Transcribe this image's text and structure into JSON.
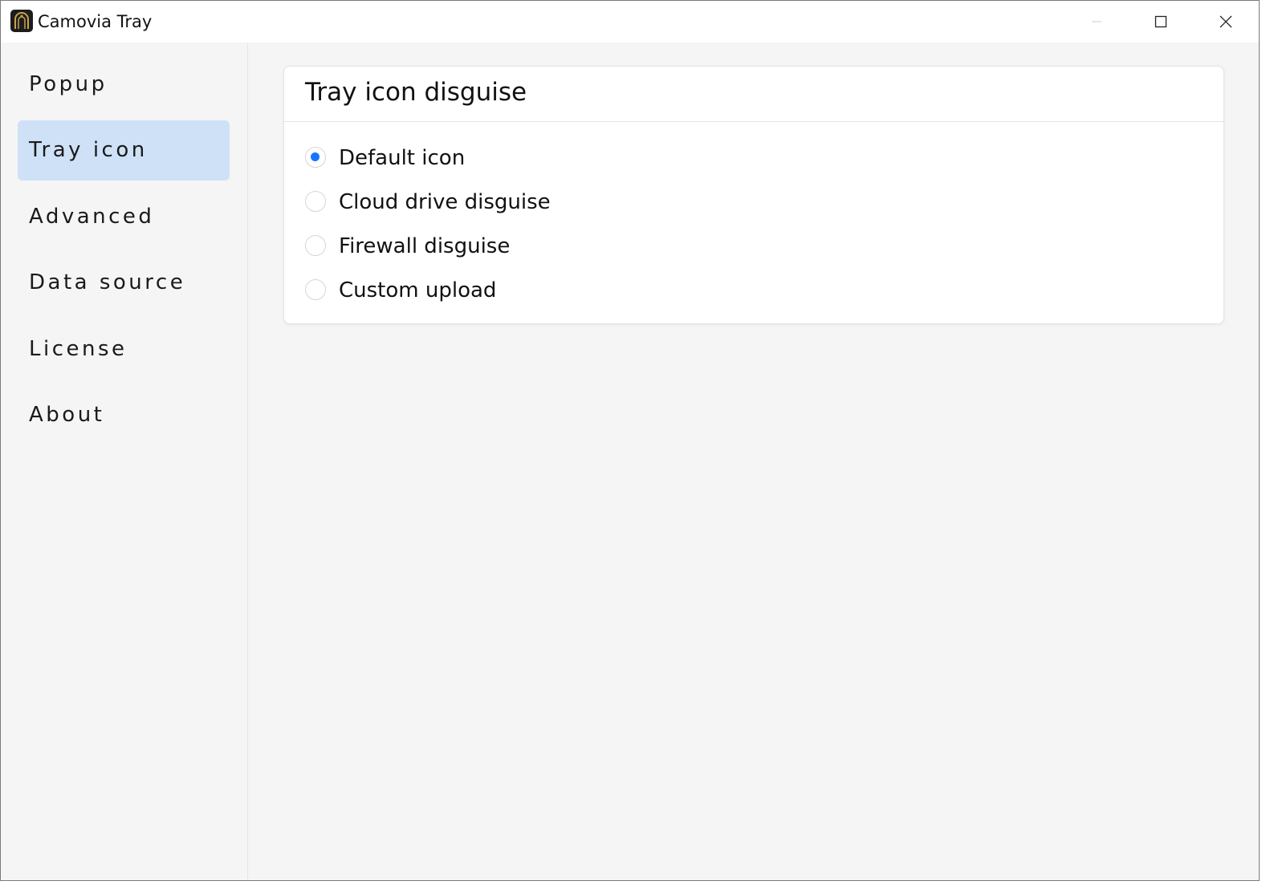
{
  "window": {
    "title": "Camovia Tray",
    "icon": "app-logo-icon",
    "controls": [
      "minimize-icon",
      "maximize-icon",
      "close-icon"
    ]
  },
  "sidebar": {
    "items": [
      {
        "label": "Popup",
        "active": false
      },
      {
        "label": "Tray icon",
        "active": true
      },
      {
        "label": "Advanced",
        "active": false
      },
      {
        "label": "Data source",
        "active": false
      },
      {
        "label": "License",
        "active": false
      },
      {
        "label": "About",
        "active": false
      }
    ]
  },
  "main": {
    "card_title": "Tray icon disguise",
    "options": [
      {
        "label": "Default icon",
        "checked": true
      },
      {
        "label": "Cloud drive disguise",
        "checked": false
      },
      {
        "label": "Firewall disguise",
        "checked": false
      },
      {
        "label": "Custom upload",
        "checked": false
      }
    ]
  },
  "colors": {
    "accent": "#1677ff",
    "nav_active_bg": "#cfe1f7",
    "background": "#f5f5f5"
  }
}
